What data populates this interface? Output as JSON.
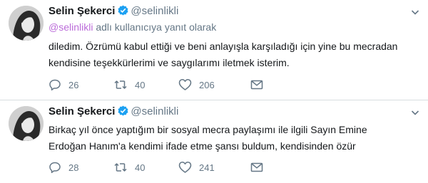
{
  "tweets": [
    {
      "name": "Selin Şekerci",
      "handle": "@selinlikli",
      "reply_to": {
        "mention": "@selinlikli",
        "suffix": " adlı kullanıcıya yanıt olarak"
      },
      "lines": [
        "diledim. Özrümü kabul ettiği ve beni anlayışla karşıladığı için yine bu mecradan",
        "kendisine teşekkürlerimi ve saygılarımı iletmek isterim."
      ],
      "replies": "26",
      "retweets": "40",
      "likes": "206"
    },
    {
      "name": "Selin Şekerci",
      "handle": "@selinlikli",
      "lines": [
        "Birkaç yıl önce yaptığım bir sosyal mecra paylaşımı ile ilgili Sayın Emine",
        "Erdoğan Hanım'a kendimi ifade etme şansı buldum, kendisinden özür"
      ],
      "replies": "28",
      "retweets": "40",
      "likes": "241"
    }
  ],
  "icons": {
    "verified": "verified-badge-icon",
    "more": "chevron-down-icon",
    "reply": "reply-icon",
    "retweet": "retweet-icon",
    "like": "heart-icon",
    "dm": "envelope-icon"
  },
  "colors": {
    "name": "#14171a",
    "secondary": "#657786",
    "verified": "#1da1f2",
    "mention": "#bb6bd9",
    "divider": "#d8dde0"
  }
}
